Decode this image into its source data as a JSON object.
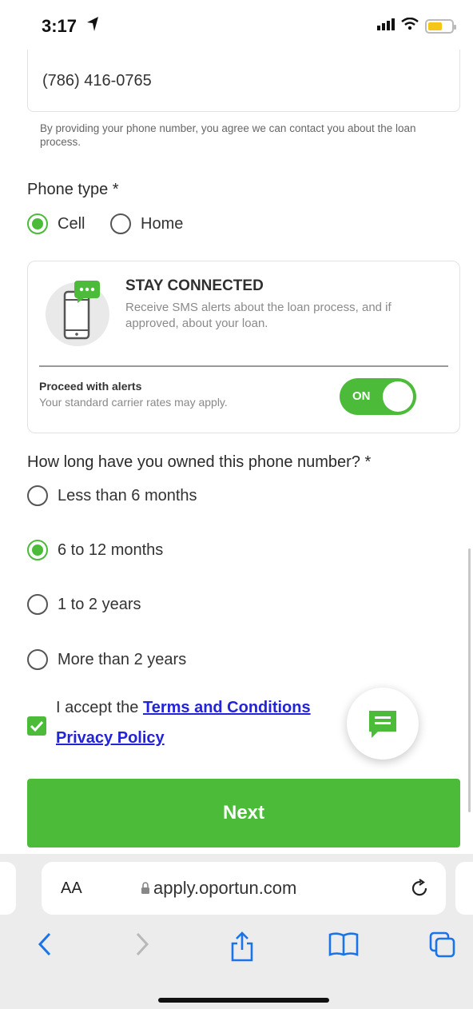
{
  "status_bar": {
    "time": "3:17"
  },
  "phone": {
    "value": "(786) 416-0765",
    "note": "By providing your phone number, you agree we can contact you about the loan process."
  },
  "phone_type": {
    "label": "Phone type *",
    "options": [
      {
        "label": "Cell",
        "checked": true
      },
      {
        "label": "Home",
        "checked": false
      }
    ]
  },
  "alerts": {
    "title": "STAY CONNECTED",
    "text": "Receive SMS alerts about the loan process, and if approved, about your loan.",
    "proceed_title": "Proceed with alerts",
    "proceed_sub": "Your standard carrier rates may apply.",
    "toggle_label": "ON",
    "toggle_on": true
  },
  "ownership": {
    "label": "How long have you owned this phone number? *",
    "options": [
      {
        "label": "Less than 6 months",
        "checked": false
      },
      {
        "label": "6 to 12 months",
        "checked": true
      },
      {
        "label": "1 to 2 years",
        "checked": false
      },
      {
        "label": "More than 2 years",
        "checked": false
      }
    ]
  },
  "terms": {
    "prefix": "I accept the ",
    "terms_link": "Terms and Conditions",
    "privacy_link": "Privacy Policy",
    "checked": true
  },
  "next_button": "Next",
  "browser": {
    "text_size": "AA",
    "url": "apply.oportun.com"
  },
  "colors": {
    "accent": "#4cbb3a",
    "link": "#2323d8",
    "ios_blue": "#1a73e8"
  }
}
